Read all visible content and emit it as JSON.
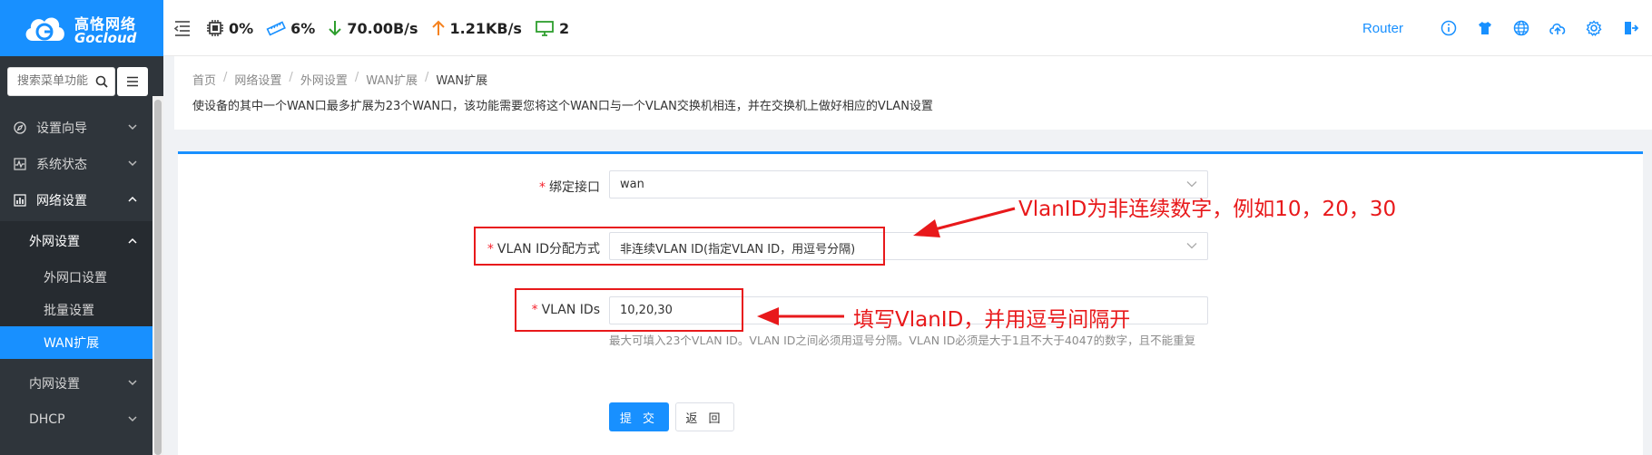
{
  "header": {
    "brand_cn": "高恪网络",
    "brand_en": "Gocloud",
    "stats": {
      "cpu": "0%",
      "memory": "6%",
      "download": "70.00B/s",
      "upload": "1.21KB/s",
      "clients": "2"
    },
    "router_label": "Router",
    "icons": [
      "info-icon",
      "theme-shirt-icon",
      "language-globe-icon",
      "cloud-upload-icon",
      "gear-icon",
      "logout-icon"
    ]
  },
  "sidebar": {
    "search_placeholder": "搜索菜单功能",
    "items": [
      {
        "label": "设置向导"
      },
      {
        "label": "系统状态"
      },
      {
        "label": "网络设置"
      },
      {
        "label": "外网设置"
      },
      {
        "label": "外网口设置"
      },
      {
        "label": "批量设置"
      },
      {
        "label": "WAN扩展"
      },
      {
        "label": "内网设置"
      },
      {
        "label": "DHCP"
      }
    ]
  },
  "breadcrumb": [
    "首页",
    "网络设置",
    "外网设置",
    "WAN扩展",
    "WAN扩展"
  ],
  "page_desc": "使设备的其中一个WAN口最多扩展为23个WAN口，该功能需要您将这个WAN口与一个VLAN交换机相连，并在交换机上做好相应的VLAN设置",
  "form": {
    "bind_iface_label": "绑定接口",
    "bind_iface_value": "wan",
    "vlan_mode_label": "VLAN ID分配方式",
    "vlan_mode_value": "非连续VLAN ID(指定VLAN ID，用逗号分隔)",
    "vlan_ids_label": "VLAN IDs",
    "vlan_ids_value": "10,20,30",
    "hint": "最大可填入23个VLAN ID。VLAN ID之间必须用逗号分隔。VLAN ID必须是大于1且不大于4047的数字，且不能重复",
    "submit_label": "提 交",
    "back_label": "返 回"
  },
  "annotations": {
    "note1": "VlanID为非连续数字，例如10，20，30",
    "note2": "填写VlanID，并用逗号间隔开",
    "color": "#e8191b"
  },
  "colors": {
    "primary": "#1890ff",
    "sidebar_bg": "#2f353b"
  }
}
